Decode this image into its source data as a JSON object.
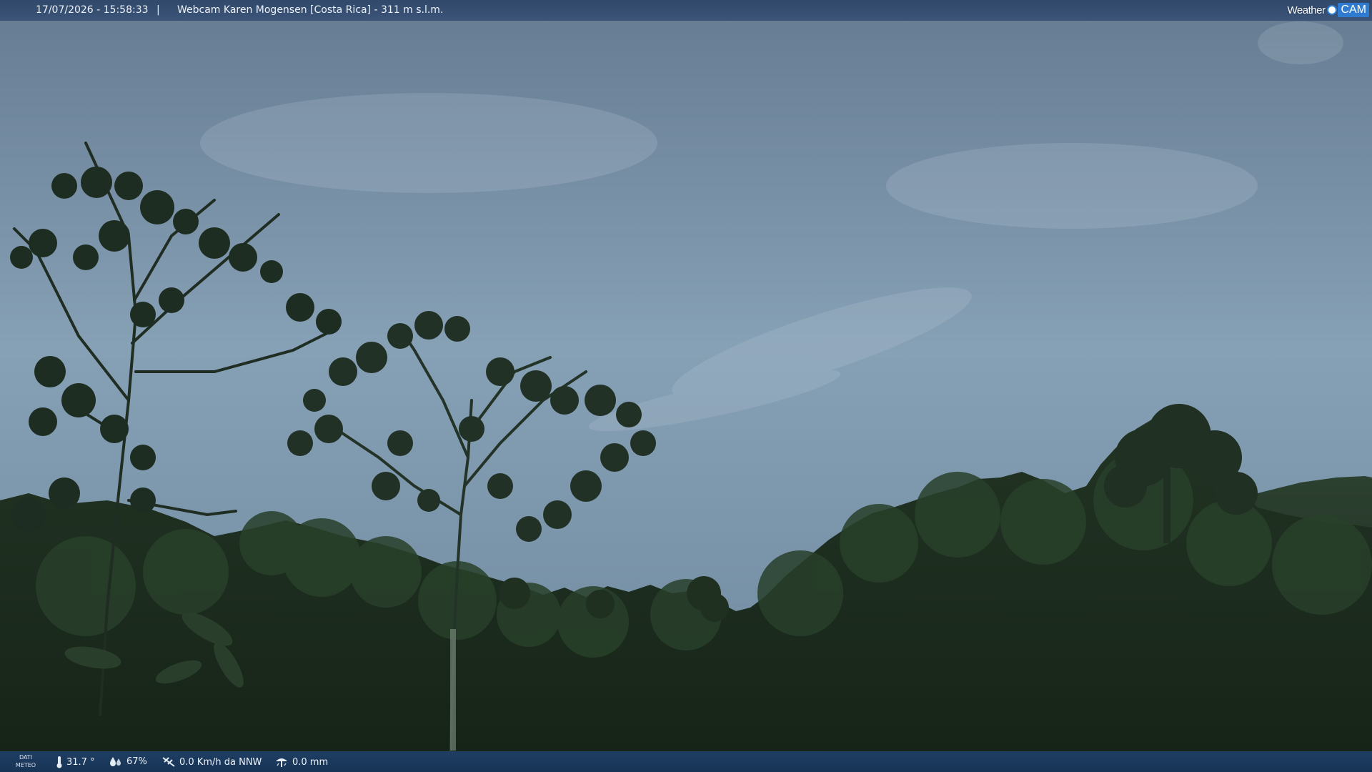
{
  "topbar": {
    "datetime": "17/07/2026 - 15:58:33",
    "separator": "|",
    "title": "Webcam Karen Mogensen [Costa Rica] - 311 m s.l.m."
  },
  "brand": {
    "weather": "Weather",
    "cam": "CAM"
  },
  "bottombar": {
    "label_line1": "DATI",
    "label_line2": "METEO",
    "temperature": "31.7 °",
    "humidity": "67%",
    "wind": "0.0 Km/h da NNW",
    "rain": "0.0 mm"
  },
  "icons": {
    "temperature": "thermometer-icon",
    "humidity": "humidity-drops-icon",
    "wind": "wind-vane-icon",
    "rain": "rain-gauge-icon"
  },
  "colors": {
    "bar_top": "#34506f",
    "bar_bottom": "#1c3a5c",
    "brand_cam": "#2e7bd1",
    "sky": "#7d97ad",
    "forest": "#1c2b1c"
  }
}
